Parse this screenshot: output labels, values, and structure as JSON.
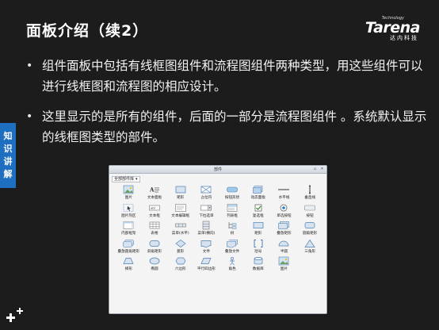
{
  "slide": {
    "title": "面板介绍（续2）",
    "logo": {
      "small": "Technology",
      "main": "Tarena",
      "cn": "达内科技"
    },
    "side_tab": "知识讲解",
    "bullets": [
      {
        "text": "组件面板中包括有线框图组件和流程图组件两种类型，用这些组件可以进行线框图和流程图的相应设计。"
      },
      {
        "text": "这里显示的是所有的组件，后面的一部分是流程图组件 。系统默认显示的线框图类型的部件。"
      }
    ]
  },
  "window": {
    "title": "部件",
    "library_select": "全部部件库",
    "components": [
      {
        "label": "图片",
        "icon": "image-icon"
      },
      {
        "label": "文本面板",
        "icon": "text-panel-icon"
      },
      {
        "label": "矩形",
        "icon": "rectangle-icon"
      },
      {
        "label": "占位符",
        "icon": "placeholder-icon"
      },
      {
        "label": "按钮形状",
        "icon": "button-shape-icon"
      },
      {
        "label": "动态面板",
        "icon": "dynamic-panel-icon"
      },
      {
        "label": "水平线",
        "icon": "horizontal-line-icon"
      },
      {
        "label": "垂直线",
        "icon": "vertical-line-icon"
      },
      {
        "label": "图片热区",
        "icon": "hotspot-icon"
      },
      {
        "label": "文本框",
        "icon": "textbox-icon"
      },
      {
        "label": "文本编辑框",
        "icon": "text-editor-icon"
      },
      {
        "label": "下拉选单",
        "icon": "dropdown-icon"
      },
      {
        "label": "列表框",
        "icon": "listbox-icon"
      },
      {
        "label": "复选框",
        "icon": "checkbox-icon"
      },
      {
        "label": "单选按钮",
        "icon": "radio-icon"
      },
      {
        "label": "按钮",
        "icon": "button-icon"
      },
      {
        "label": "内部框架",
        "icon": "iframe-icon"
      },
      {
        "label": "表格",
        "icon": "table-icon"
      },
      {
        "label": "菜单(水平)",
        "icon": "menu-horizontal-icon"
      },
      {
        "label": "菜单(横向)",
        "icon": "menu-vertical-icon"
      },
      {
        "label": "树",
        "icon": "tree-icon"
      },
      {
        "label": "矩形",
        "icon": "flow-rectangle-icon"
      },
      {
        "label": "叠放矩形",
        "icon": "stacked-rect-icon"
      },
      {
        "label": "圆角矩形",
        "icon": "rounded-rect-icon"
      },
      {
        "label": "叠放圆角矩形",
        "icon": "stacked-rounded-icon"
      },
      {
        "label": "斜角矩形",
        "icon": "bevel-rect-icon"
      },
      {
        "label": "菱形",
        "icon": "diamond-icon"
      },
      {
        "label": "文件",
        "icon": "file-icon"
      },
      {
        "label": "叠放文件",
        "icon": "stacked-file-icon"
      },
      {
        "label": "括号",
        "icon": "bracket-icon"
      },
      {
        "label": "半圆",
        "icon": "semicircle-icon"
      },
      {
        "label": "三角形",
        "icon": "triangle-icon"
      },
      {
        "label": "梯形",
        "icon": "trapezoid-icon"
      },
      {
        "label": "椭圆",
        "icon": "ellipse-icon"
      },
      {
        "label": "六边形",
        "icon": "hexagon-icon"
      },
      {
        "label": "平行四边形",
        "icon": "parallelogram-icon"
      },
      {
        "label": "角色",
        "icon": "actor-icon"
      },
      {
        "label": "数据库",
        "icon": "database-icon"
      },
      {
        "label": "图片",
        "icon": "flow-image-icon"
      }
    ]
  },
  "colors": {
    "background": "#1c1c1c",
    "side_tab": "#1f6fc0",
    "icon_fill": "#d6e2ef",
    "icon_stroke": "#4f7fb0"
  }
}
